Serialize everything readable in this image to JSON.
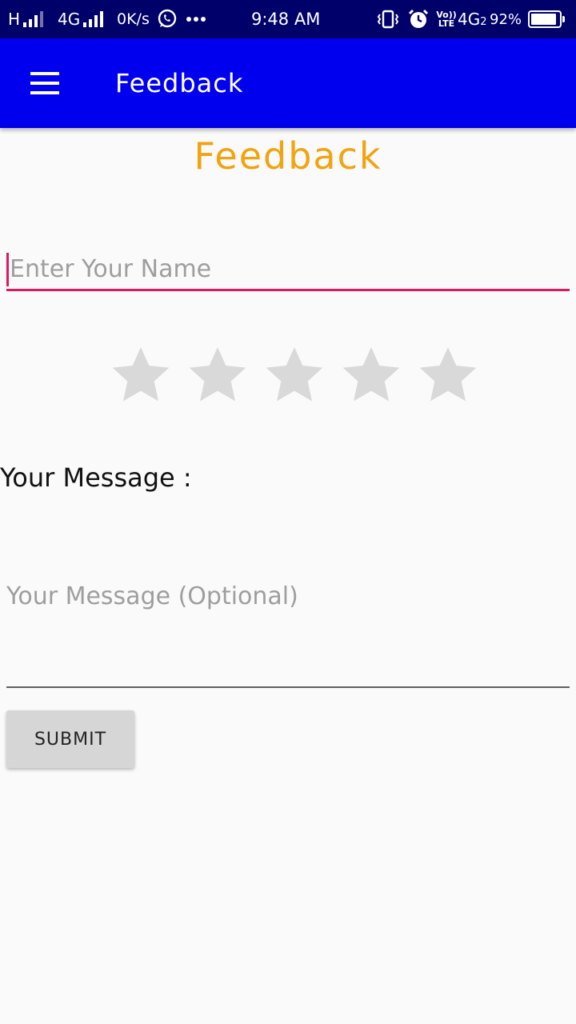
{
  "status_bar": {
    "network_type_1": "H",
    "network_type_2": "4G",
    "data_speed": "0K/s",
    "notification_icons": [
      "whatsapp-icon",
      "more-notifications-icon"
    ],
    "time": "9:48 AM",
    "right_icons": [
      "vibrate-icon",
      "alarm-icon"
    ],
    "volte_label": "Vo)) LTE",
    "network_type_3": "4G",
    "sim_number": "2",
    "battery_percent_text": "92%",
    "battery_level": 0.92,
    "background_color": "#00006a"
  },
  "app_bar": {
    "title": "Feedback",
    "menu_icon": "hamburger-menu-icon",
    "background_color": "#0000ee"
  },
  "form": {
    "heading": "Feedback",
    "heading_color": "#f2a310",
    "name_input": {
      "placeholder": "Enter Your Name",
      "value": "",
      "accent_color": "#d81b60"
    },
    "rating": {
      "max_stars": 5,
      "value": 0,
      "empty_star_color": "#d9d9d9"
    },
    "message_label": "Your Message :",
    "message_input": {
      "placeholder": "Your Message (Optional)",
      "value": ""
    },
    "submit_label": "SUBMIT"
  }
}
